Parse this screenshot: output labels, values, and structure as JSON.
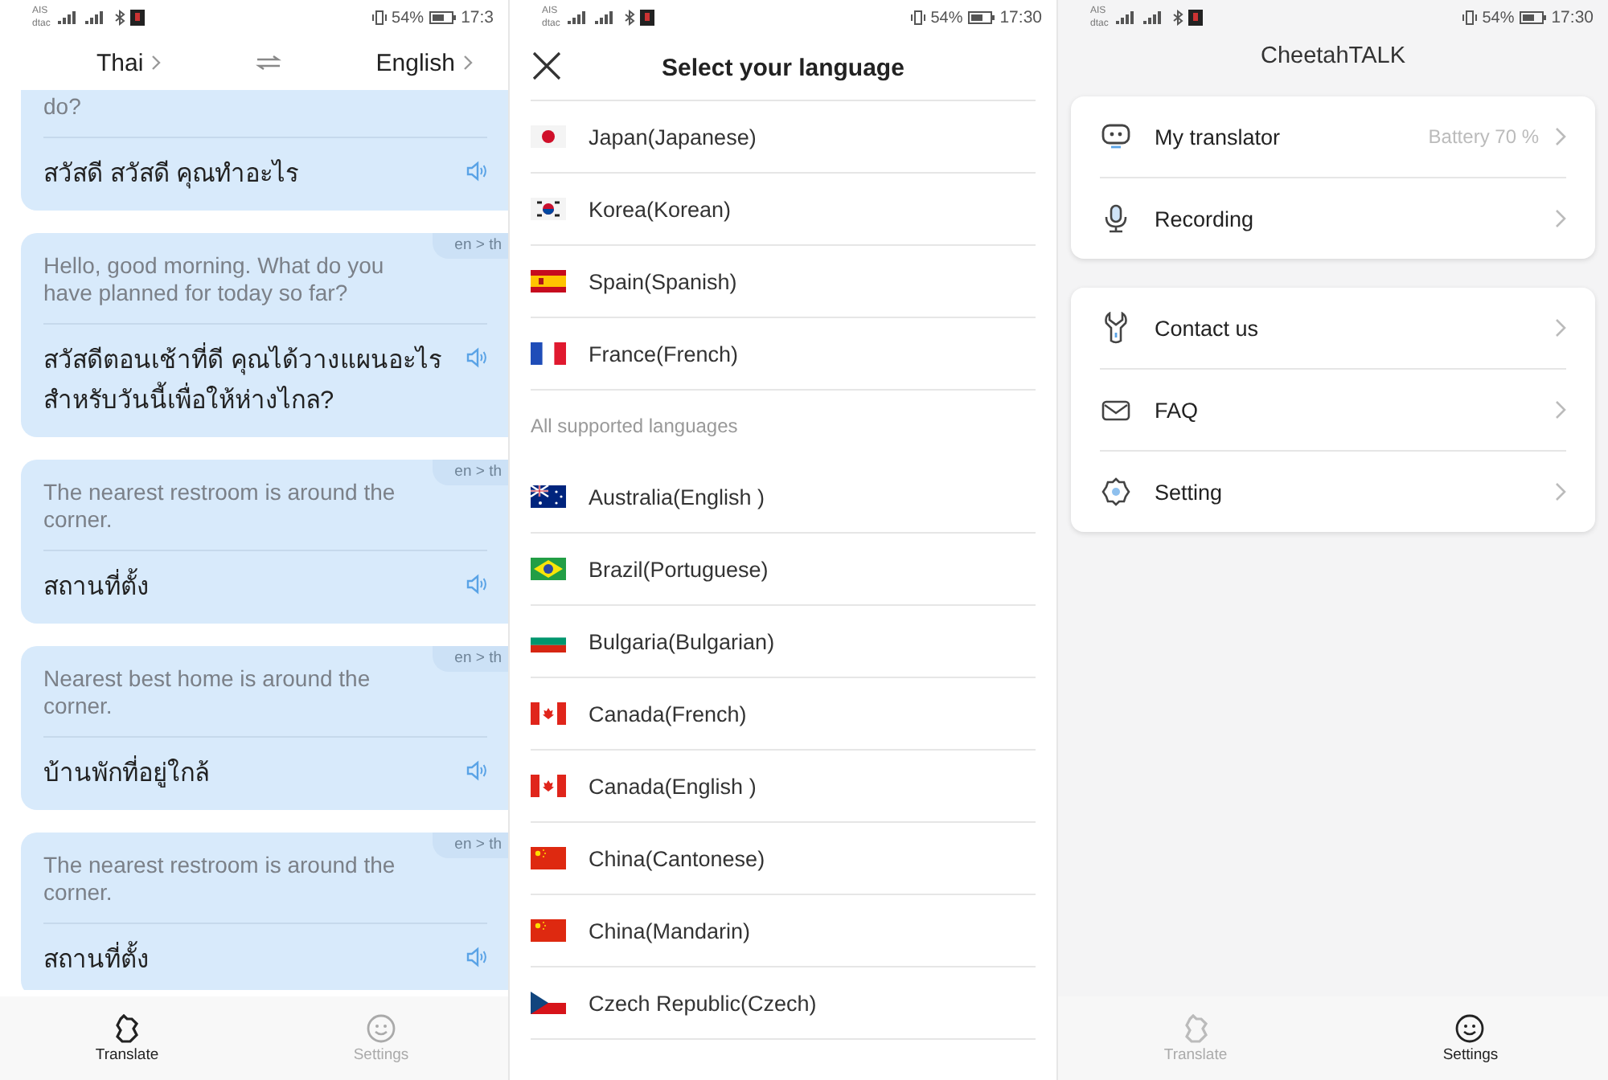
{
  "translate_screen": {
    "status_bar": {
      "carrier_1": "AIS",
      "carrier_2": "dtac",
      "battery": "54%",
      "time": "17:3"
    },
    "source_language": "Thai",
    "target_language": "English",
    "messages": [
      {
        "source": "do?",
        "target": "สวัสดี สวัสดี คุณทำอะไร"
      },
      {
        "direction": "en > th",
        "source": "Hello, good morning. What do you have planned for today so far?",
        "target": "สวัสดีตอนเช้าที่ดี คุณได้วางแผนอะไรสำหรับวันนี้เพื่อให้ห่างไกล?"
      },
      {
        "direction": "en > th",
        "source": "The nearest restroom is around the corner.",
        "target": "สถานที่ตั้ง"
      },
      {
        "direction": "en > th",
        "source": "Nearest best home is around the corner.",
        "target": "บ้านพักที่อยู่ใกล้"
      },
      {
        "direction": "en > th",
        "source": "The nearest restroom is around the corner.",
        "target": "สถานที่ตั้ง"
      }
    ],
    "nav": [
      {
        "kind": "translate",
        "label": "Translate",
        "selected": true
      },
      {
        "kind": "settings",
        "label": "Settings",
        "selected": false
      }
    ]
  },
  "language_screen": {
    "status_bar": {
      "carrier_1": "AIS",
      "carrier_2": "dtac",
      "battery": "54%",
      "time": "17:30"
    },
    "title": "Select your language",
    "recent": [
      {
        "kind": "jp",
        "label": "Japan(Japanese)"
      },
      {
        "kind": "kr",
        "label": "Korea(Korean)"
      },
      {
        "kind": "es",
        "label": "Spain(Spanish)"
      },
      {
        "kind": "fr",
        "label": "France(French)"
      }
    ],
    "section_label": "All supported languages",
    "languages": [
      {
        "kind": "au",
        "label": "Australia(English )"
      },
      {
        "kind": "br",
        "label": "Brazil(Portuguese)"
      },
      {
        "kind": "bg",
        "label": "Bulgaria(Bulgarian)"
      },
      {
        "kind": "ca",
        "label": "Canada(French)"
      },
      {
        "kind": "ca",
        "label": "Canada(English )"
      },
      {
        "kind": "cn",
        "label": "China(Cantonese)"
      },
      {
        "kind": "cn",
        "label": "China(Mandarin)"
      },
      {
        "kind": "cz",
        "label": "Czech Republic(Czech)"
      }
    ]
  },
  "settings_screen": {
    "status_bar": {
      "carrier_1": "AIS",
      "carrier_2": "dtac",
      "battery": "54%",
      "time": "17:30"
    },
    "title": "CheetahTALK",
    "groups": [
      [
        {
          "kind": "robot",
          "label": "My translator",
          "value": "Battery 70 %"
        },
        {
          "kind": "mic",
          "label": "Recording"
        }
      ],
      [
        {
          "kind": "wrench",
          "label": "Contact us"
        },
        {
          "kind": "mail",
          "label": "FAQ"
        },
        {
          "kind": "gear",
          "label": "Setting"
        }
      ]
    ],
    "nav": [
      {
        "kind": "translate",
        "label": "Translate",
        "selected": false
      },
      {
        "kind": "settings",
        "label": "Settings",
        "selected": true
      }
    ]
  }
}
